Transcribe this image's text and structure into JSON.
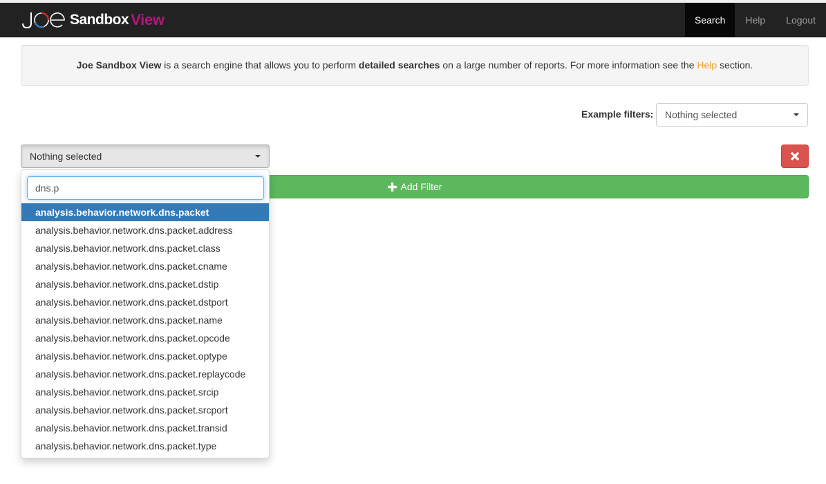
{
  "navbar": {
    "brand": {
      "logo_text_joe": "Joe",
      "logo_text_sandbox": "Sandbox",
      "logo_text_view": "View",
      "view_color": "#b5157a"
    },
    "items": [
      {
        "label": "Search",
        "active": true
      },
      {
        "label": "Help",
        "active": false
      },
      {
        "label": "Logout",
        "active": false
      }
    ]
  },
  "intro": {
    "brand_name": "Joe Sandbox View",
    "text_1": " is a search engine that allows you to perform ",
    "emphasis": "detailed searches",
    "text_2": " on a large number of reports. For more information see the ",
    "help_link": "Help",
    "text_3": " section.",
    "link_color": "#f0a030"
  },
  "example_filters": {
    "label": "Example filters:",
    "selected": "Nothing selected"
  },
  "filter": {
    "field_select_value": "Nothing selected",
    "remove_icon": "times-icon",
    "add_button_label": "Add Filter",
    "add_icon": "plus-icon",
    "dropdown": {
      "search_value": "dns.p",
      "options": [
        {
          "label": "analysis.behavior.network.dns.packet",
          "highlighted": true
        },
        {
          "label": "analysis.behavior.network.dns.packet.address",
          "highlighted": false
        },
        {
          "label": "analysis.behavior.network.dns.packet.class",
          "highlighted": false
        },
        {
          "label": "analysis.behavior.network.dns.packet.cname",
          "highlighted": false
        },
        {
          "label": "analysis.behavior.network.dns.packet.dstip",
          "highlighted": false
        },
        {
          "label": "analysis.behavior.network.dns.packet.dstport",
          "highlighted": false
        },
        {
          "label": "analysis.behavior.network.dns.packet.name",
          "highlighted": false
        },
        {
          "label": "analysis.behavior.network.dns.packet.opcode",
          "highlighted": false
        },
        {
          "label": "analysis.behavior.network.dns.packet.optype",
          "highlighted": false
        },
        {
          "label": "analysis.behavior.network.dns.packet.replaycode",
          "highlighted": false
        },
        {
          "label": "analysis.behavior.network.dns.packet.srcip",
          "highlighted": false
        },
        {
          "label": "analysis.behavior.network.dns.packet.srcport",
          "highlighted": false
        },
        {
          "label": "analysis.behavior.network.dns.packet.transid",
          "highlighted": false
        },
        {
          "label": "analysis.behavior.network.dns.packet.type",
          "highlighted": false
        }
      ]
    }
  },
  "colors": {
    "navbar_bg": "#222222",
    "nav_active_bg": "#080808",
    "danger": "#d9534f",
    "success": "#5cb85c",
    "highlight": "#337ab7"
  }
}
